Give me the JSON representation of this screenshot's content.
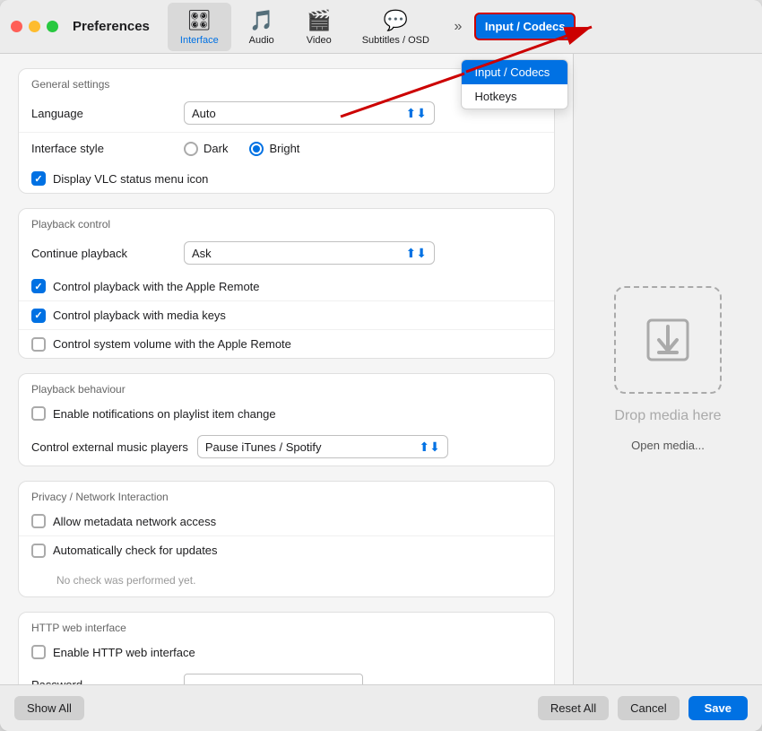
{
  "window": {
    "title": "Preferences"
  },
  "titlebar": {
    "controls": [
      "close",
      "minimize",
      "maximize"
    ],
    "title": "Preferences",
    "overflow_label": "»"
  },
  "tabs": [
    {
      "id": "interface",
      "label": "Interface",
      "icon": "🎛",
      "active": true
    },
    {
      "id": "audio",
      "label": "Audio",
      "icon": "🎵",
      "active": false
    },
    {
      "id": "video",
      "label": "Video",
      "icon": "🎬",
      "active": false
    },
    {
      "id": "subtitles",
      "label": "Subtitles / OSD",
      "icon": "💬",
      "active": false
    }
  ],
  "input_codecs": {
    "label": "Input / Codecs"
  },
  "dropdown_menu": {
    "items": [
      {
        "label": "Input / Codecs",
        "selected": true
      },
      {
        "label": "Hotkeys"
      }
    ]
  },
  "general_settings": {
    "header": "General settings",
    "language": {
      "label": "Language",
      "value": "Auto"
    },
    "interface_style": {
      "label": "Interface style",
      "options": [
        {
          "label": "Dark",
          "checked": false
        },
        {
          "label": "Bright",
          "checked": true
        }
      ]
    },
    "vlc_status_icon": {
      "label": "Display VLC status menu icon",
      "checked": true
    }
  },
  "playback_control": {
    "header": "Playback control",
    "continue_playback": {
      "label": "Continue playback",
      "value": "Ask"
    },
    "items": [
      {
        "label": "Control playback with the Apple Remote",
        "checked": true
      },
      {
        "label": "Control playback with media keys",
        "checked": true
      },
      {
        "label": "Control system volume with the Apple Remote",
        "checked": false
      }
    ]
  },
  "playback_behaviour": {
    "header": "Playback behaviour",
    "enable_notifications": {
      "label": "Enable notifications on playlist item change",
      "checked": false
    },
    "control_music_players": {
      "label": "Control external music players",
      "value": "Pause iTunes / Spotify"
    }
  },
  "privacy": {
    "header": "Privacy / Network Interaction",
    "items": [
      {
        "label": "Allow metadata network access",
        "checked": false
      },
      {
        "label": "Automatically check for updates",
        "checked": false
      }
    ],
    "hint": "No check was performed yet."
  },
  "http_web": {
    "header": "HTTP web interface",
    "enable": {
      "label": "Enable HTTP web interface",
      "checked": false
    },
    "password_label": "Password"
  },
  "drop_zone": {
    "text": "Drop media here",
    "open_label": "Open media..."
  },
  "bottom_bar": {
    "show_all": "Show All",
    "reset_all": "Reset All",
    "cancel": "Cancel",
    "save": "Save"
  }
}
